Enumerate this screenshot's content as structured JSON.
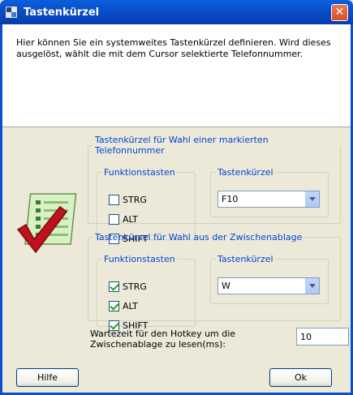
{
  "window": {
    "title": "Tastenkürzel"
  },
  "info": {
    "text": "Hier können Sie ein systemweites Tastenkürzel definieren. Wird dieses ausgelöst, wählt  die mit dem Cursor selektierte Telefonnummer."
  },
  "group1": {
    "title": "Tastenkürzel für Wahl einer markierten Telefonnummer",
    "modifiers_title": "Funktionstasten",
    "modifiers": [
      {
        "label": "STRG",
        "checked": false
      },
      {
        "label": "ALT",
        "checked": false
      },
      {
        "label": "SHIFT",
        "checked": false
      }
    ],
    "key_title": "Tastenkürzel",
    "key_value": "F10"
  },
  "group2": {
    "title": "Tastenkürzel für Wahl aus der Zwischenablage",
    "modifiers_title": "Funktionstasten",
    "modifiers": [
      {
        "label": "STRG",
        "checked": true
      },
      {
        "label": "ALT",
        "checked": true
      },
      {
        "label": "SHIFT",
        "checked": true
      }
    ],
    "key_title": "Tastenkürzel",
    "key_value": "W"
  },
  "wait": {
    "label": "Wartezeit für den Hotkey um die Zwischenablage zu lesen(ms):",
    "value": "10"
  },
  "buttons": {
    "help": "Hilfe",
    "ok": "Ok"
  },
  "icons": {
    "title": "app-icon",
    "emblem": "checklist-icon",
    "close": "close-icon"
  }
}
